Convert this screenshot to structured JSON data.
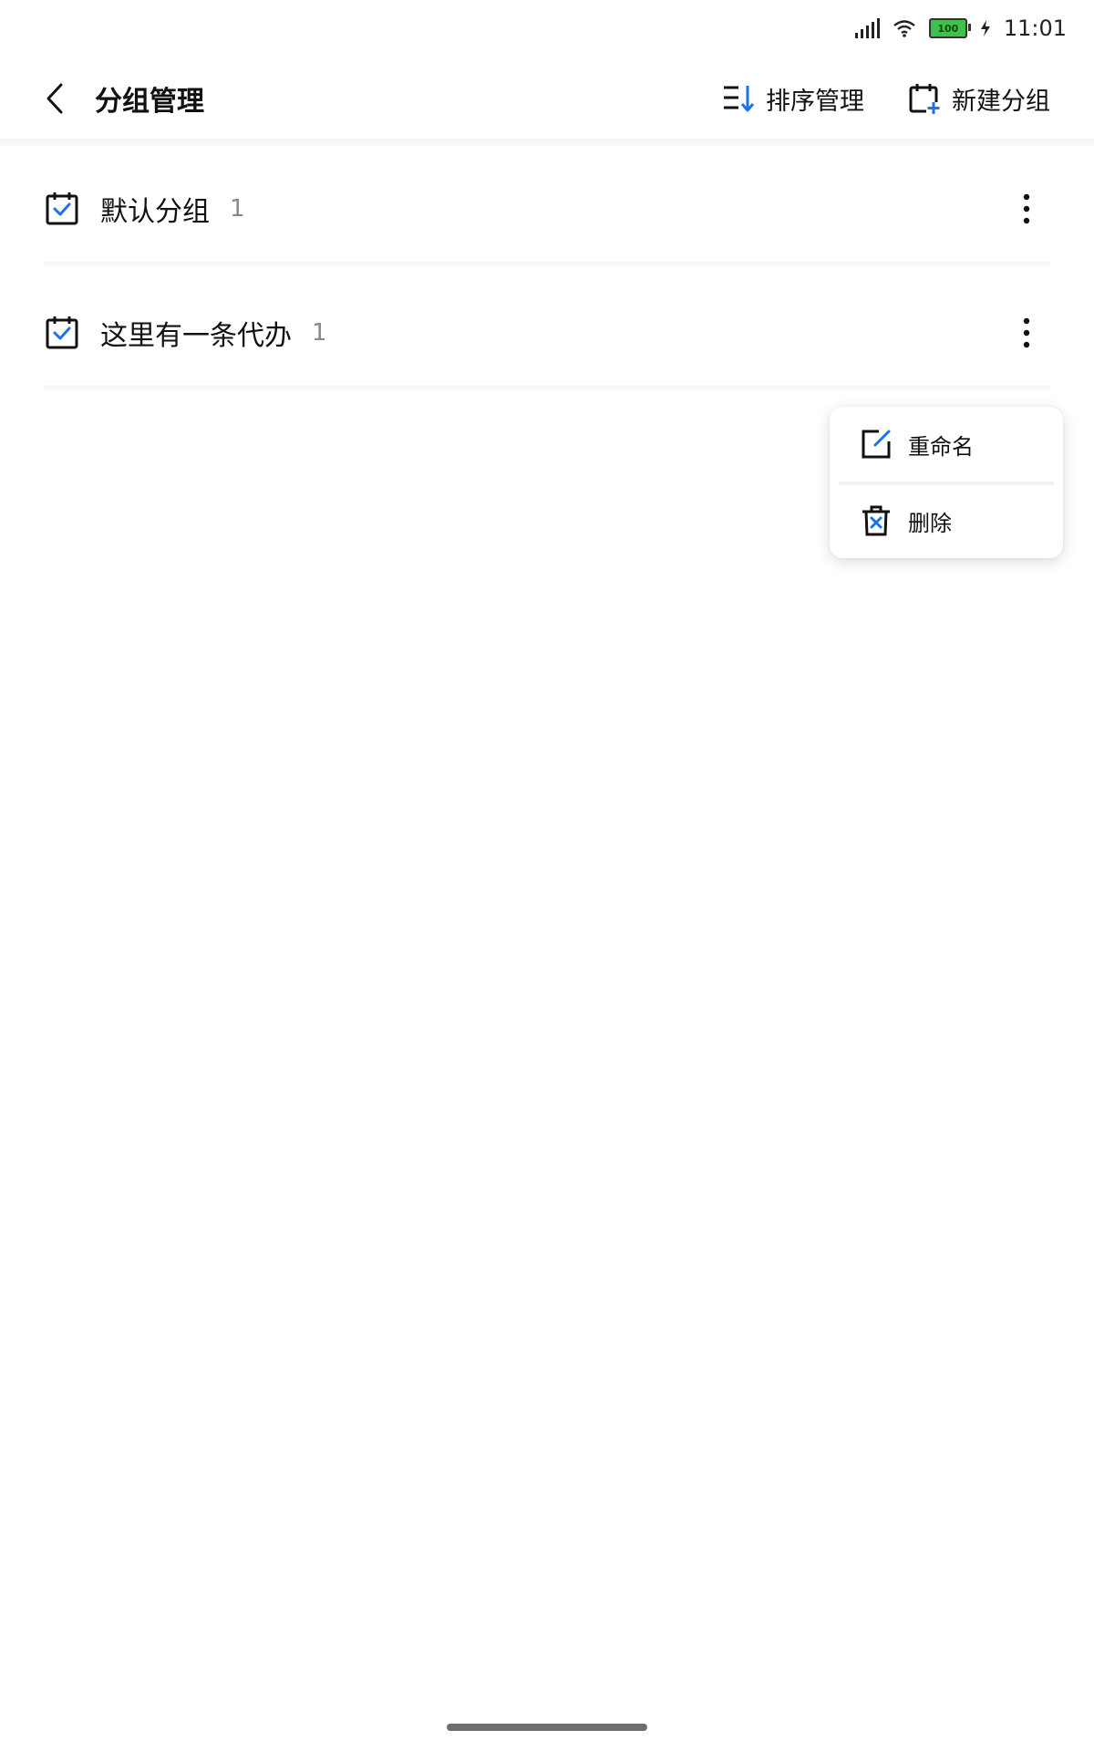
{
  "status_bar": {
    "time": "11:01",
    "battery_level": "100",
    "icons": [
      "signal-icon",
      "wifi-icon",
      "battery-icon",
      "charging-icon"
    ]
  },
  "header": {
    "title": "分组管理",
    "sort_label": "排序管理",
    "new_group_label": "新建分组"
  },
  "groups": [
    {
      "name": "默认分组",
      "count": "1"
    },
    {
      "name": "这里有一条代办",
      "count": "1"
    }
  ],
  "popup_menu": {
    "rename_label": "重命名",
    "delete_label": "删除"
  },
  "colors": {
    "accent": "#1a73e8",
    "text_primary": "#111111",
    "text_secondary": "#888888"
  }
}
